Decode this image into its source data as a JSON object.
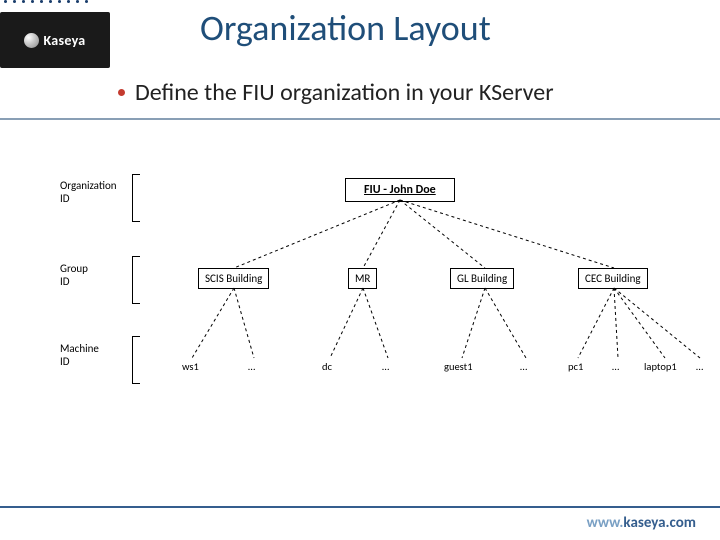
{
  "brand": {
    "name": "Kaseya"
  },
  "title": "Organization Layout",
  "bullet_text": "Define the FIU organization in your KServer",
  "levels": {
    "org_label": "Organization\nID",
    "group_label": "Group\nID",
    "machine_label": "Machine\nID"
  },
  "tree": {
    "root": "FIU - John Doe",
    "groups": [
      "SCIS Building",
      "MR",
      "GL Building",
      "CEC Building"
    ],
    "machines_row": [
      "ws1",
      "…",
      "dc",
      "…",
      "guest1",
      "…",
      "pc1",
      "…",
      "laptop1",
      "…"
    ]
  },
  "footer": {
    "prefix": "www.",
    "domain": "kaseya.com"
  }
}
